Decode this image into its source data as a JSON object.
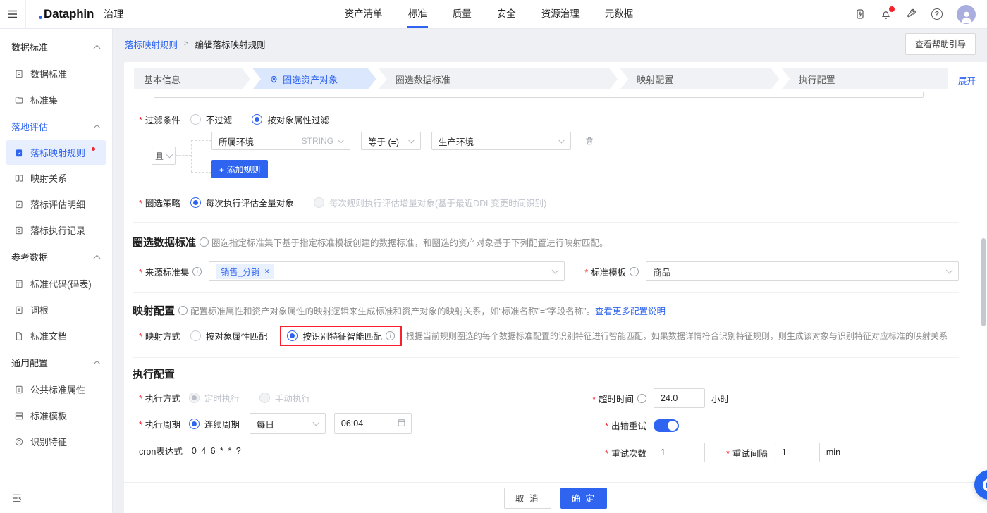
{
  "colors": {
    "primary": "#2E64F0",
    "danger": "#F5222D",
    "active_step_bg": "#DBE7FD",
    "sidebar_active_bg": "#E7EFFF"
  },
  "topnav": {
    "logo": "Dataphin",
    "product": "治理",
    "menu": [
      {
        "label": "资产清单",
        "active": false
      },
      {
        "label": "标准",
        "active": true
      },
      {
        "label": "质量",
        "active": false
      },
      {
        "label": "安全",
        "active": false
      },
      {
        "label": "资源治理",
        "active": false
      },
      {
        "label": "元数据",
        "active": false
      }
    ],
    "icons": [
      "power-icon",
      "bell-icon",
      "wrench-icon",
      "help-icon",
      "avatar"
    ]
  },
  "sidebar": {
    "sections": [
      {
        "title": "数据标准",
        "items": [
          {
            "label": "数据标准"
          },
          {
            "label": "标准集"
          }
        ]
      },
      {
        "title": "落地评估",
        "items": [
          {
            "label": "落标映射规则",
            "active": true,
            "badge": true
          },
          {
            "label": "映射关系"
          },
          {
            "label": "落标评估明细"
          },
          {
            "label": "落标执行记录"
          }
        ]
      },
      {
        "title": "参考数据",
        "items": [
          {
            "label": "标准代码(码表)"
          },
          {
            "label": "词根"
          },
          {
            "label": "标准文档"
          }
        ]
      },
      {
        "title": "通用配置",
        "items": [
          {
            "label": "公共标准属性"
          },
          {
            "label": "标准模板"
          },
          {
            "label": "识别特征"
          }
        ]
      }
    ]
  },
  "breadcrumb": {
    "parent": "落标映射规则",
    "separator": ">",
    "current": "编辑落标映射规则"
  },
  "page": {
    "help_button": "查看帮助引导",
    "expand_link": "展开"
  },
  "wizard": {
    "steps": [
      {
        "label": "基本信息",
        "active": false
      },
      {
        "label": "圈选资产对象",
        "active": true
      },
      {
        "label": "圈选数据标准",
        "active": false
      },
      {
        "label": "映射配置",
        "active": false
      },
      {
        "label": "执行配置",
        "active": false
      }
    ]
  },
  "form": {
    "filter": {
      "label": "过滤条件",
      "opt_no": "不过滤",
      "opt_by_attr": "按对象属性过滤",
      "selected": "按对象属性过滤"
    },
    "rule": {
      "conjunction": "且",
      "field": "所属环境",
      "field_type": "STRING",
      "operator": "等于 (=)",
      "value": "生产环境",
      "add_button": "+ 添加规则"
    },
    "strategy": {
      "label": "圈选策略",
      "opt_full": "每次执行评估全量对象",
      "opt_incr": "每次规则执行评估增量对象(基于最近DDL变更时间识别)",
      "selected": "每次执行评估全量对象"
    },
    "standards": {
      "title": "圈选数据标准",
      "desc": "圈选指定标准集下基于指定标准模板创建的数据标准，和圈选的资产对象基于下列配置进行映射匹配。",
      "source_label": "来源标准集",
      "source_tag": "销售_分销",
      "template_label": "标准模板",
      "template_value": "商品"
    },
    "mapping": {
      "title": "映射配置",
      "desc": "配置标准属性和资产对象属性的映射逻辑来生成标准和资产对象的映射关系，如“标准名称”=“字段名称”。",
      "link": "查看更多配置说明",
      "label": "映射方式",
      "opt_attr": "按对象属性匹配",
      "opt_smart": "按识别特征智能匹配",
      "selected": "按识别特征智能匹配",
      "hint": "根据当前规则圈选的每个数据标准配置的识别特征进行智能匹配，如果数据详情符合识别特征规则，则生成该对象与识别特征对应标准的映射关系"
    },
    "exec": {
      "title": "执行配置",
      "mode_label": "执行方式",
      "mode_timed": "定时执行",
      "mode_manual": "手动执行",
      "mode_selected": "定时执行",
      "cycle_label": "执行周期",
      "cycle_opt": "连续周期",
      "freq": "每日",
      "time": "06:04",
      "cron_label": "cron表达式",
      "cron": "0 4 6 * * ?",
      "timeout_label": "超时时间",
      "timeout": "24.0",
      "timeout_unit": "小时",
      "retry_label": "出错重试",
      "retry_on": true,
      "retry_count_label": "重试次数",
      "retry_count": "1",
      "retry_interval_label": "重试间隔",
      "retry_interval": "1",
      "retry_interval_unit": "min"
    }
  },
  "footer": {
    "cancel": "取 消",
    "ok": "确 定"
  }
}
